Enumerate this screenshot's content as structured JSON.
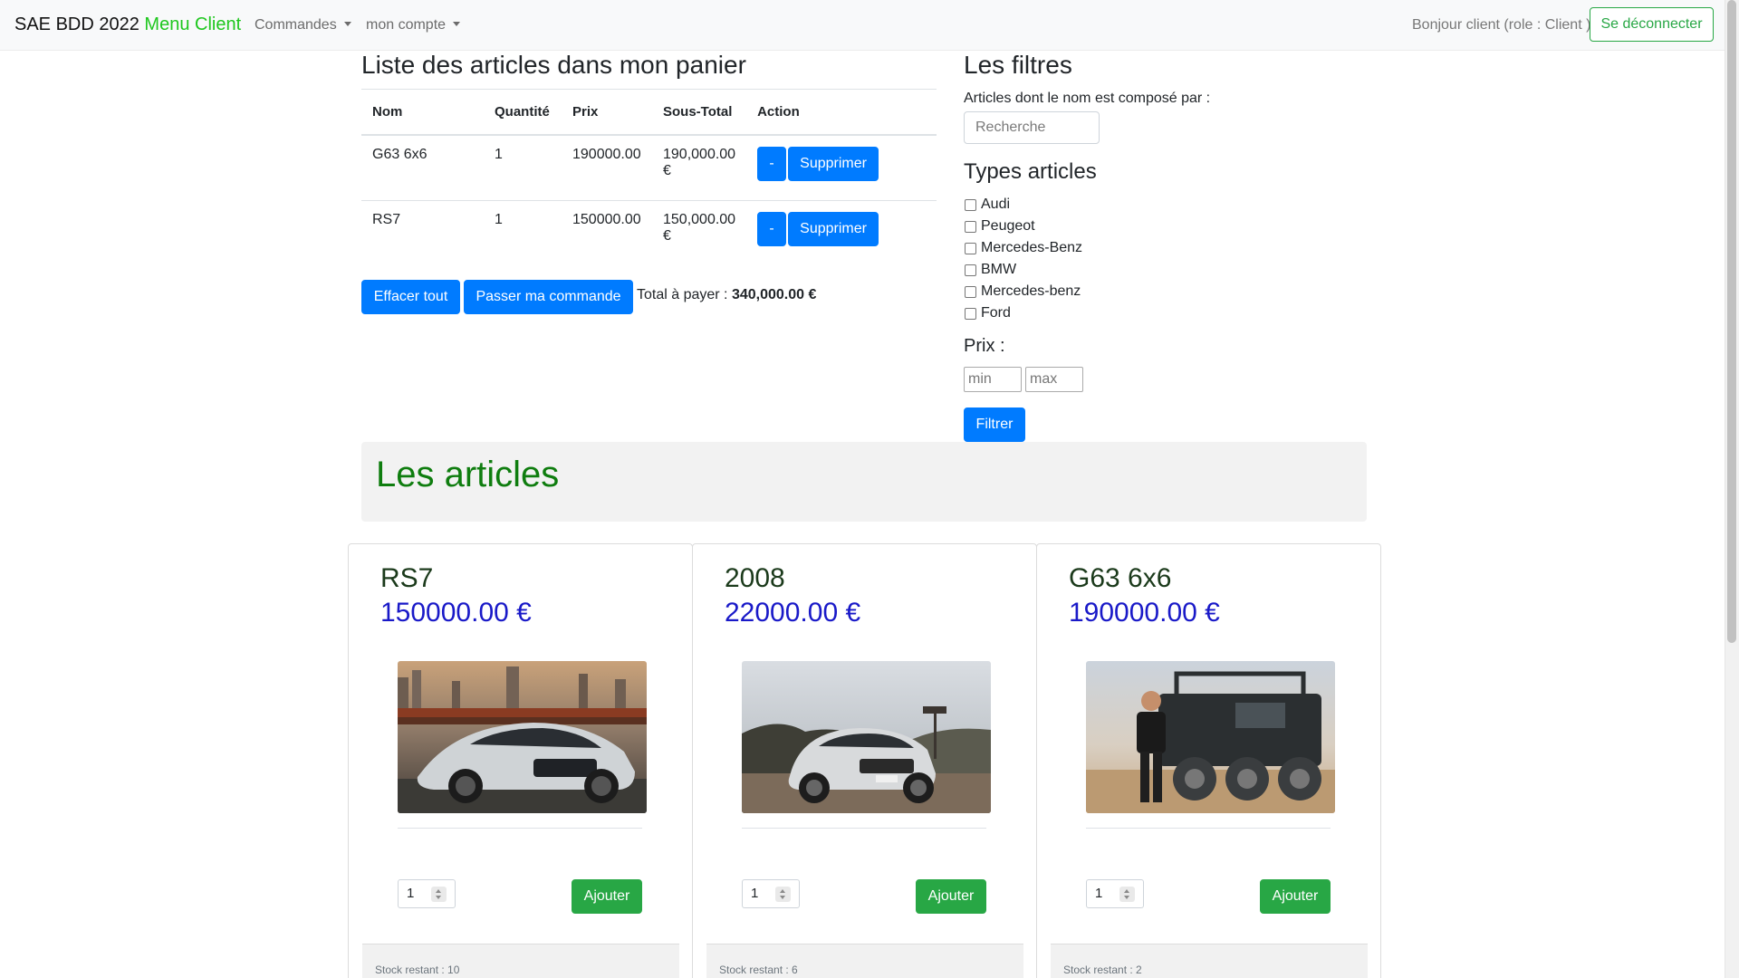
{
  "navbar": {
    "brand": "SAE BDD 2022",
    "brand_accent": "Menu Client",
    "menu_commandes": "Commandes",
    "menu_compte": "mon compte",
    "greeting": "Bonjour client (role : Client )",
    "logout_label": "Se déconnecter"
  },
  "cart": {
    "title": "Liste des articles dans mon panier",
    "headers": {
      "nom": "Nom",
      "quantite": "Quantité",
      "prix": "Prix",
      "sous_total": "Sous-Total",
      "action": "Action"
    },
    "rows": [
      {
        "nom": "G63 6x6",
        "quantite": "1",
        "prix": "190000.00",
        "sous_total": "190,000.00 €",
        "minus_label": "-",
        "delete_label": "Supprimer"
      },
      {
        "nom": "RS7",
        "quantite": "1",
        "prix": "150000.00",
        "sous_total": "150,000.00 €",
        "minus_label": "-",
        "delete_label": "Supprimer"
      }
    ],
    "clear_label": "Effacer tout",
    "order_label": "Passer ma commande",
    "total_label": "Total à payer :",
    "total_value": "340,000.00 €"
  },
  "filters": {
    "title": "Les filtres",
    "name_label": "Articles dont le nom est composé par :",
    "search_placeholder": "Recherche",
    "types_title": "Types articles",
    "types": [
      "Audi",
      "Peugeot",
      "Mercedes-Benz",
      "BMW",
      "Mercedes-benz",
      "Ford"
    ],
    "price_title": "Prix :",
    "min_placeholder": "min",
    "max_placeholder": "max",
    "filter_label": "Filtrer"
  },
  "articles": {
    "title": "Les articles",
    "items": [
      {
        "name": "RS7",
        "price": "150000.00 €",
        "qty": "1",
        "add_label": "Ajouter",
        "stock": "Stock restant : 10"
      },
      {
        "name": "2008",
        "price": "22000.00 €",
        "qty": "1",
        "add_label": "Ajouter",
        "stock": "Stock restant : 6"
      },
      {
        "name": "G63 6x6",
        "price": "190000.00 €",
        "qty": "1",
        "add_label": "Ajouter",
        "stock": "Stock restant : 2"
      }
    ]
  },
  "colors": {
    "primary": "#007bff",
    "success": "#28a745",
    "brand_accent": "#1ec71e",
    "articles_title": "#0f7d0f",
    "price": "#1919c8"
  }
}
